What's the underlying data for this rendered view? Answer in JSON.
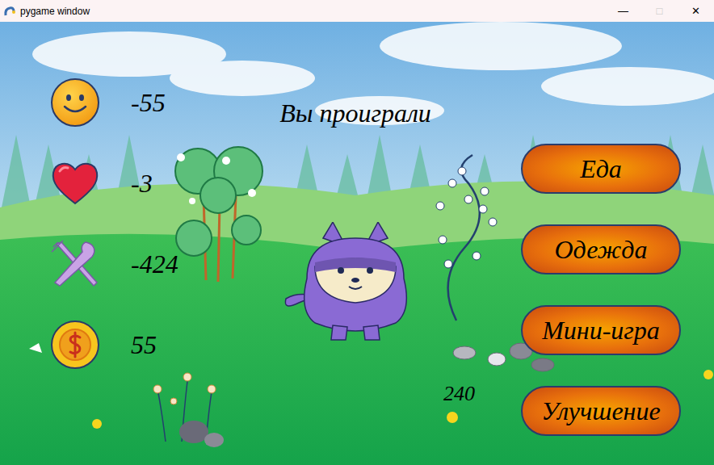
{
  "window": {
    "title": "pygame window",
    "controls": [
      {
        "glyph": "—",
        "disabled": false
      },
      {
        "glyph": "□",
        "disabled": true
      },
      {
        "glyph": "✕",
        "disabled": false
      }
    ]
  },
  "stats": [
    {
      "kind": "mood",
      "value": "-55"
    },
    {
      "kind": "health",
      "value": "-3"
    },
    {
      "kind": "food",
      "value": "-424"
    },
    {
      "kind": "money",
      "value": "55"
    }
  ],
  "status": "Вы проиграли",
  "buttons": [
    "Еда",
    "Одежда",
    "Мини-игра",
    "Улучшение"
  ],
  "counter": "240"
}
